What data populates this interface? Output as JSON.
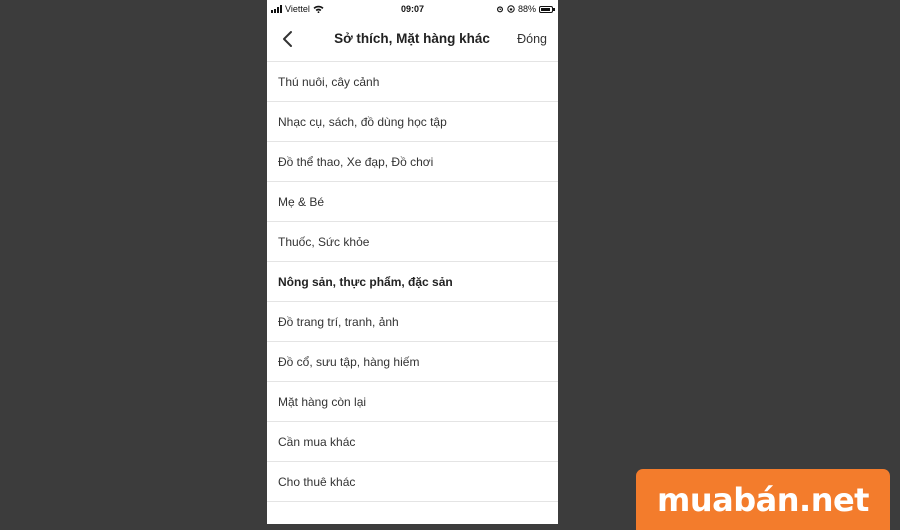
{
  "status_bar": {
    "carrier": "Viettel",
    "time": "09:07",
    "battery": "88%",
    "battery_level": 0.88,
    "icons": [
      "signal-icon",
      "wifi-icon",
      "alarm-icon",
      "orientation-lock-icon",
      "battery-icon"
    ]
  },
  "nav": {
    "back_icon": "chevron-left-icon",
    "title": "Sở thích, Mặt hàng khác",
    "close_label": "Đóng"
  },
  "categories": [
    "Thú nuôi, cây cảnh",
    "Nhạc cụ, sách, đồ dùng học tập",
    "Đồ thể thao, Xe đạp, Đồ chơi",
    "Mẹ & Bé",
    "Thuốc, Sức khỏe",
    "Nông sản, thực phẩm, đặc sản",
    "Đồ trang trí, tranh, ảnh",
    "Đồ cổ, sưu tập, hàng hiếm",
    "Mặt hàng còn lại",
    "Cần mua khác",
    "Cho thuê khác"
  ],
  "highlighted_index": 5,
  "watermark": {
    "text": "muabán.net",
    "color": "#f37c2c"
  }
}
